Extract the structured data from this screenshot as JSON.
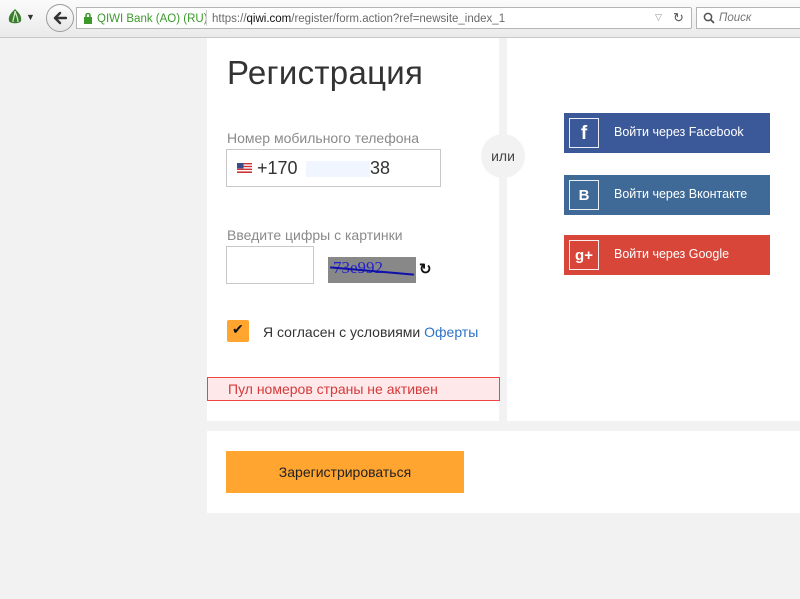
{
  "browser": {
    "identity_label": "QIWI Bank (AO) (RU)",
    "url_prefix": "https://",
    "url_host": "qiwi.com",
    "url_path": "/register/form.action?ref=newsite_index_1",
    "search_placeholder": "Поиск"
  },
  "form": {
    "title": "Регистрация",
    "phone_label": "Номер мобильного телефона",
    "phone_prefix": "+170",
    "phone_suffix": "38",
    "captcha_label": "Введите цифры с картинки",
    "captcha_text": "73e992",
    "agree_text": "Я согласен с условиями",
    "agree_link": "Оферты",
    "error_text": "Пул номеров страны не активен",
    "register_button": "Зарегистрироваться",
    "or_label": "или"
  },
  "social": [
    {
      "label": "Войти через Facebook",
      "icon": "facebook-icon",
      "color": "#3b5998"
    },
    {
      "label": "Войти через Вконтакте",
      "icon": "vk-icon",
      "color": "#3f6a98"
    },
    {
      "label": "Войти через Google",
      "icon": "google-plus-icon",
      "color": "#d8463a"
    }
  ],
  "colors": {
    "accent": "#ffa530",
    "error": "#d43a3a",
    "link": "#2d73c8"
  }
}
